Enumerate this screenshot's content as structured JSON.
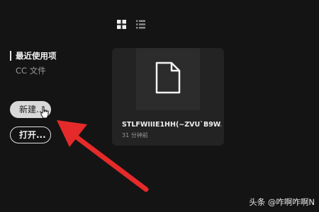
{
  "view_toggle": {
    "grid_icon": "grid-view-icon",
    "list_icon": "list-view-icon",
    "active": "grid"
  },
  "nav": {
    "recent": "最近使用项",
    "cc_files": "CC 文件"
  },
  "buttons": {
    "new": "新建...",
    "open": "打开..."
  },
  "file": {
    "name": "STLFWIIIE1HH(~ZVU`B9W...",
    "time": "31 分钟前",
    "icon": "document-icon"
  },
  "annotation": {
    "arrow_color": "#e52a2a"
  },
  "watermark": "头条 @咋啊咋啊N"
}
